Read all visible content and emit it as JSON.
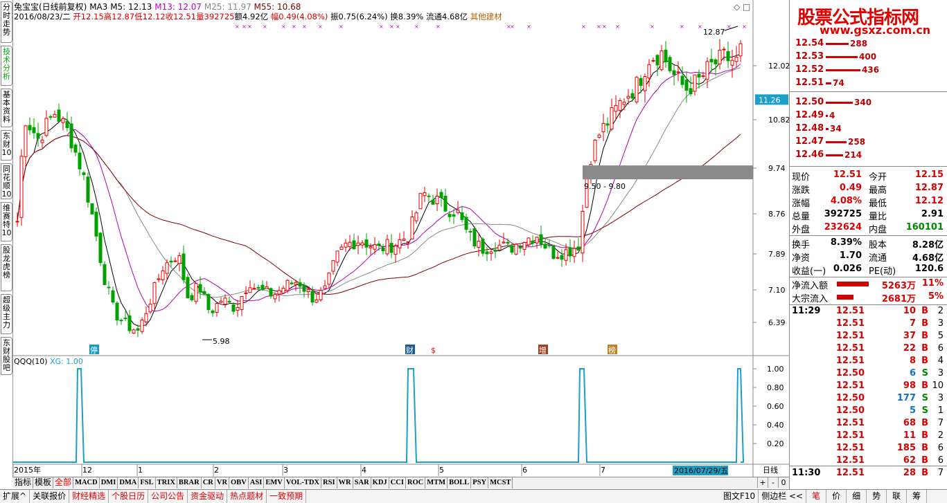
{
  "left_tabs": [
    {
      "label": "分时走势"
    },
    {
      "label": "技术分析",
      "active": true
    },
    {
      "label": "基本资料"
    },
    {
      "label": "东财10"
    },
    {
      "label": "同花顺10"
    },
    {
      "label": "维赛特10"
    },
    {
      "label": "股龙虎榜"
    },
    {
      "label": "超级主力"
    },
    {
      "label": "东财股吧"
    }
  ],
  "header": {
    "stock": "兔宝宝(日线前复权)",
    "ma3": "MA3",
    "ma5": "M5: 12.13",
    "ma13": "M13: 12.07",
    "ma25": "M25: 11.97",
    "ma55": "M55: 10.68",
    "line2": [
      {
        "t": "2016/08/23/二 ",
        "c": "#000"
      },
      {
        "t": "开12.15",
        "c": "#d00"
      },
      {
        "t": "高12.87",
        "c": "#d00"
      },
      {
        "t": "低12.12",
        "c": "#d00"
      },
      {
        "t": "收12.51",
        "c": "#d00"
      },
      {
        "t": "量392725",
        "c": "#d00"
      },
      {
        "t": "额4.92亿 ",
        "c": "#000"
      },
      {
        "t": "幅0.49(4.08%)",
        "c": "#d00"
      },
      {
        "t": " 振0.75(6.24%) 换8.39% 流通4.68亿 ",
        "c": "#000"
      },
      {
        "t": "其他建材",
        "c": "#b06000"
      }
    ]
  },
  "chart_data": {
    "type": "candlestick",
    "title": "兔宝宝(日线前复权)",
    "price_axis": {
      "ticks": [
        12.02,
        10.82,
        9.74,
        8.76,
        7.89,
        7.1,
        6.39
      ],
      "current": "11.26"
    },
    "annotations": {
      "high": "12.87",
      "low": "5.98",
      "zone": "9.50 - 9.80"
    },
    "x_labels": [
      "2015年",
      "12",
      "1",
      "2",
      "3",
      "4",
      "5",
      "6",
      "7"
    ],
    "x_cursor": "2016/07/29/五",
    "event_badges": [
      "停",
      "财",
      "$",
      "增",
      "榜"
    ],
    "indicator": {
      "name": "QQQ(10)",
      "xg_label": "XG: 1.00",
      "ticks": [
        "1.00",
        "0.80",
        "0.60",
        "0.40",
        "0.20"
      ],
      "spikes": [
        "12",
        "4",
        "7",
        "8"
      ]
    },
    "period": "日线"
  },
  "order_book": {
    "sells": [
      {
        "p": "12.54",
        "v": "288"
      },
      {
        "p": "12.53",
        "v": "400"
      },
      {
        "p": "12.52",
        "v": "436"
      },
      {
        "p": "12.51",
        "v": "74"
      }
    ],
    "buys": [
      {
        "p": "12.50",
        "v": "340"
      },
      {
        "p": "12.49",
        "v": "4"
      },
      {
        "p": "12.48",
        "v": "34"
      },
      {
        "p": "12.47",
        "v": "258"
      },
      {
        "p": "12.46",
        "v": "214"
      }
    ]
  },
  "quote": [
    {
      "k1": "现价",
      "v1": "12.51",
      "k2": "今开",
      "v2": "12.15"
    },
    {
      "k1": "涨跌",
      "v1": "0.49",
      "k2": "最高",
      "v2": "12.87"
    },
    {
      "k1": "涨幅",
      "v1": "4.08%",
      "k2": "最低",
      "v2": "12.12"
    },
    {
      "k1": "总量",
      "v1": "392725",
      "k2": "量比",
      "v2": "2.91"
    },
    {
      "k1": "外盘",
      "v1": "232624",
      "k2": "内盘",
      "v2": "160101"
    }
  ],
  "fund": [
    {
      "k1": "换手",
      "v1": "8.39%",
      "k2": "股本",
      "v2": "8.28亿"
    },
    {
      "k1": "净资",
      "v1": "1.70",
      "k2": "流通",
      "v2": "4.68亿"
    },
    {
      "k1": "收益(一)",
      "v1": "0.026",
      "k2": "PE(动)",
      "v2": "120.6"
    }
  ],
  "flows": [
    {
      "k": "净流入额",
      "v": "5263万",
      "p": "11%"
    },
    {
      "k": "大宗流入",
      "v": "2681万",
      "p": "5%"
    }
  ],
  "ticks": [
    {
      "t": "11:29",
      "p": "12.51",
      "v": "10",
      "s": "B",
      "n": "2"
    },
    {
      "t": "",
      "p": "12.51",
      "v": "7",
      "s": "B",
      "n": "3"
    },
    {
      "t": "",
      "p": "12.51",
      "v": "37",
      "s": "B",
      "n": "5"
    },
    {
      "t": "",
      "p": "12.51",
      "v": "22",
      "s": "B",
      "n": "6"
    },
    {
      "t": "",
      "p": "12.51",
      "v": "8",
      "s": "B",
      "n": "4"
    },
    {
      "t": "",
      "p": "12.50",
      "v": "6",
      "s": "S",
      "n": "3"
    },
    {
      "t": "",
      "p": "12.51",
      "v": "98",
      "s": "B",
      "n": "10"
    },
    {
      "t": "",
      "p": "12.50",
      "v": "177",
      "s": "S",
      "n": "3"
    },
    {
      "t": "",
      "p": "12.50",
      "v": "5",
      "s": "S",
      "n": "1"
    },
    {
      "t": "",
      "p": "12.51",
      "v": "68",
      "s": "B",
      "n": "7"
    },
    {
      "t": "",
      "p": "12.51",
      "v": "11",
      "s": "B",
      "n": "2"
    },
    {
      "t": "",
      "p": "12.51",
      "v": "185",
      "s": "B",
      "n": "6"
    },
    {
      "t": "",
      "p": "12.51",
      "v": "62",
      "s": "B",
      "n": "6"
    },
    {
      "t": "11:30",
      "p": "12.51",
      "v": "28",
      "s": "B",
      "n": "7"
    }
  ],
  "indicator_tabs": [
    "指标",
    "模板",
    "全部",
    "MACD",
    "DMI",
    "DMA",
    "FSL",
    "TRIX",
    "BRAR",
    "CR",
    "VR",
    "OBV",
    "ASI",
    "EMV",
    "VOL-TDX",
    "RSI",
    "WR",
    "SAR",
    "KDJ",
    "CCI",
    "ROC",
    "MTM",
    "BOLL",
    "PSY",
    "MCST"
  ],
  "status_left": [
    {
      "t": "扩展^",
      "c": "#000"
    },
    {
      "t": "关联报价",
      "c": "#000"
    },
    {
      "t": "财经精选",
      "c": "#d00"
    },
    {
      "t": "个股日历",
      "c": "#d00"
    },
    {
      "t": "公司公告",
      "c": "#d00"
    },
    {
      "t": "资金驱动",
      "c": "#d00"
    },
    {
      "t": "热点题材",
      "c": "#d00"
    },
    {
      "t": "一致预期",
      "c": "#d00"
    }
  ],
  "status_right": {
    "chart_f10": "图文F10",
    "sidebar": "侧边栏 <<",
    "tabs": [
      "笔",
      "价",
      "细",
      "势",
      "联",
      "筹"
    ]
  },
  "zoom": {
    "plus": "+",
    "minus": "-",
    "zero": "0"
  },
  "logo": {
    "line1": "股票公式指标网",
    "line2": "www.gsxz.com.cn"
  }
}
